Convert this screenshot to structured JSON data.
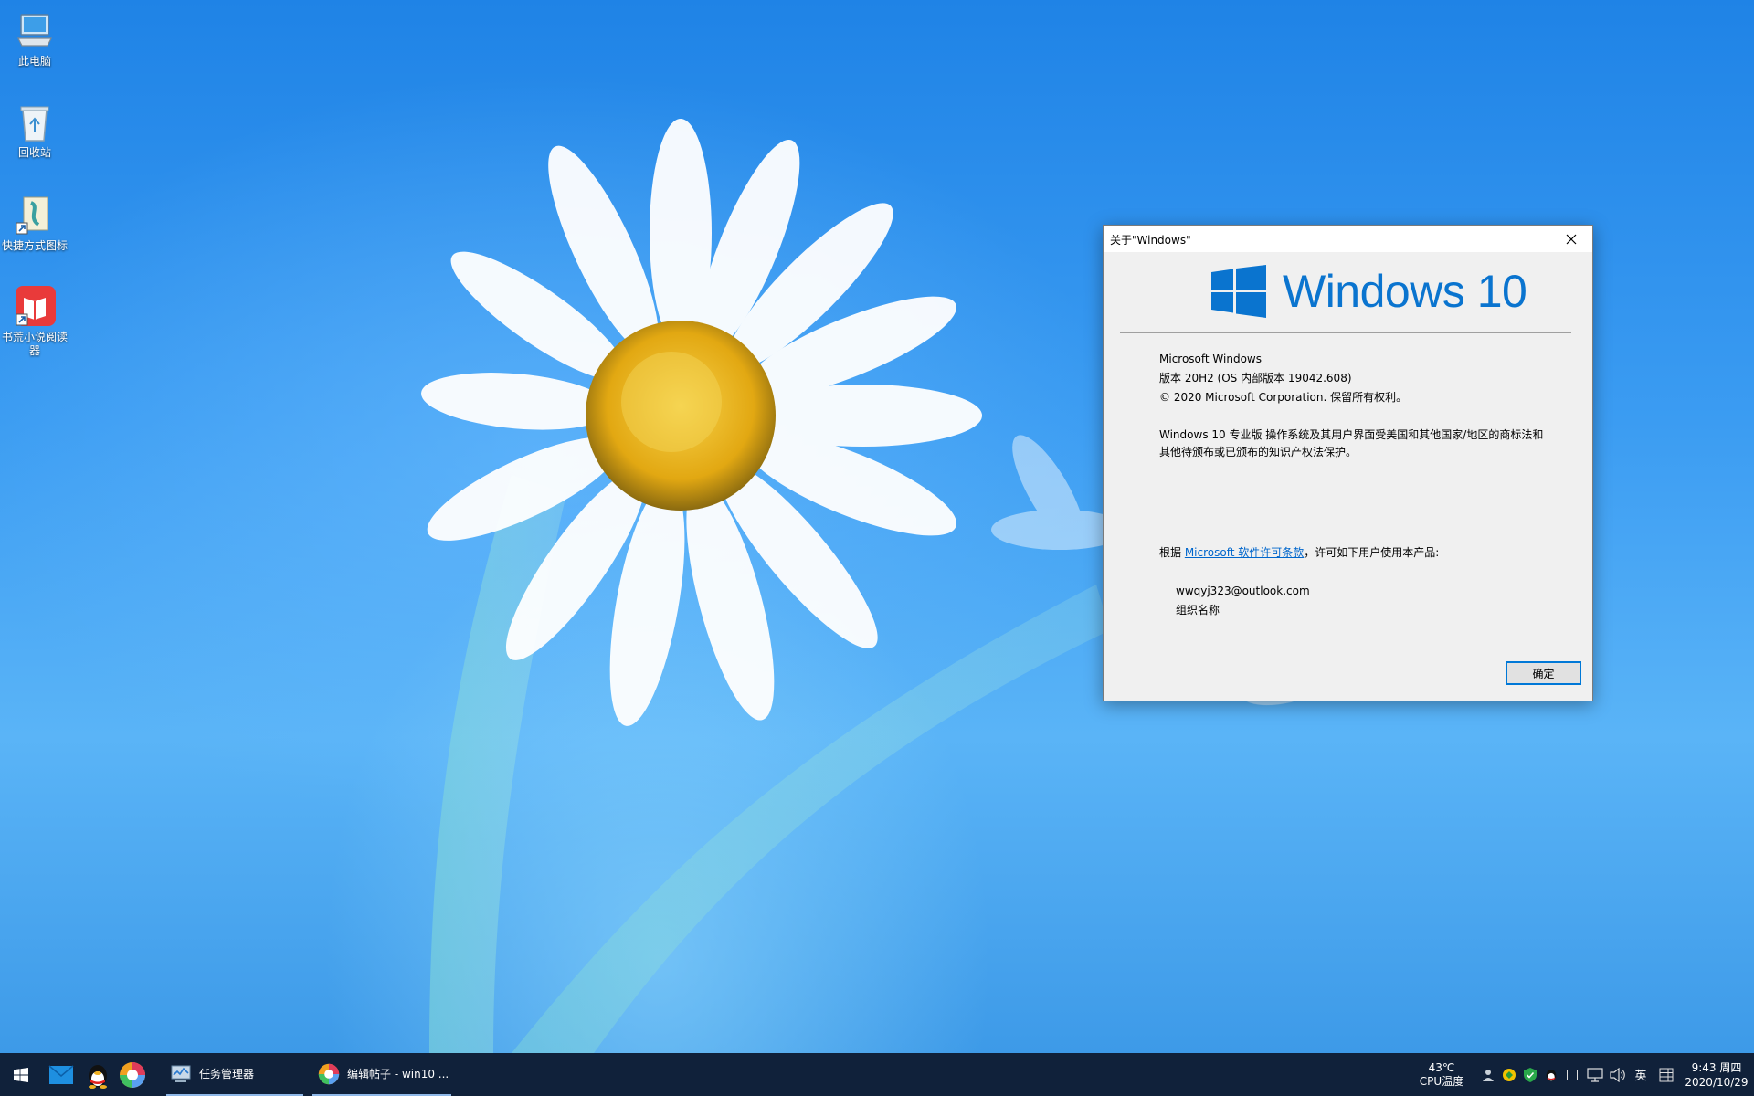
{
  "desktop": {
    "icons": [
      {
        "label": "此电脑",
        "icon": "computer-icon"
      },
      {
        "label": "回收站",
        "icon": "recycle-bin-icon"
      },
      {
        "label": "快捷方式图标",
        "icon": "shortcut-icon"
      },
      {
        "label": "书荒小说阅读器",
        "icon": "book-reader-icon"
      }
    ]
  },
  "dialog": {
    "title": "关于\"Windows\"",
    "logo_text": "Windows 10",
    "product_name": "Microsoft Windows",
    "version_line": "版本 20H2 (OS 内部版本 19042.608)",
    "copyright_line": "© 2020 Microsoft Corporation. 保留所有权利。",
    "legal_line_1": "Windows 10 专业版 操作系统及其用户界面受美国和其他国家/地区的商标法和",
    "legal_line_2": "其他待颁布或已颁布的知识产权法保护。",
    "license_prefix": "根据 ",
    "license_link": "Microsoft 软件许可条款",
    "license_suffix": "，许可如下用户使用本产品:",
    "user_name": "wwqyj323@outlook.com",
    "org_name": "组织名称",
    "ok_label": "确定",
    "accent_color": "#0a74cf"
  },
  "taskbar": {
    "apps": [
      {
        "label": "任务管理器",
        "icon": "task-manager-icon"
      },
      {
        "label": "编辑帖子 - win10 ...",
        "icon": "browser-icon"
      }
    ],
    "cpu_temp": "43℃",
    "cpu_label": "CPU温度",
    "ime": "英",
    "time": "9:43 周四",
    "date": "2020/10/29",
    "background_color": "#10213a"
  }
}
